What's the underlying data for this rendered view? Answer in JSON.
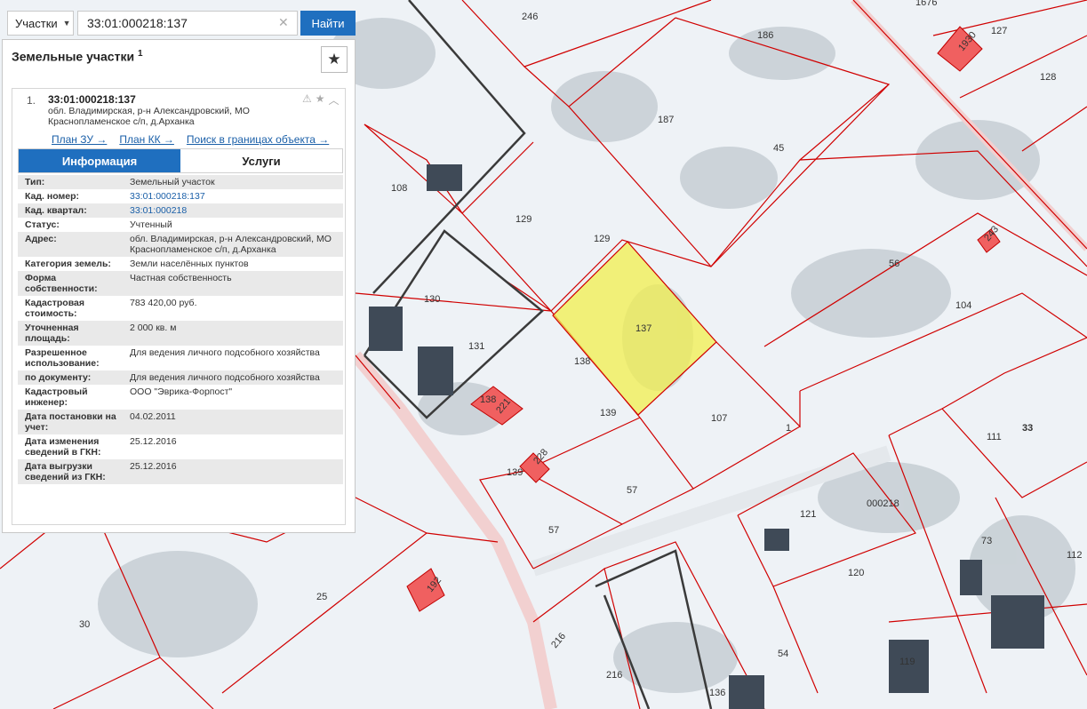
{
  "search": {
    "type_label": "Участки",
    "query": "33:01:000218:137",
    "find_label": "Найти"
  },
  "panel": {
    "title": "Земельные участки",
    "count": "1"
  },
  "result": {
    "index": "1.",
    "cad_number": "33:01:000218:137",
    "address": "обл. Владимирская, р-н Александровский, МО Краснопламенское с/п, д.Арханка",
    "links": {
      "plan_zu": "План ЗУ →",
      "plan_kk": "План КК →",
      "search_bounds": "Поиск в границах объекта →"
    },
    "tabs": {
      "info": "Информация",
      "services": "Услуги"
    },
    "details": [
      {
        "key": "Тип:",
        "value": "Земельный участок"
      },
      {
        "key": "Кад. номер:",
        "value": "33:01:000218:137"
      },
      {
        "key": "Кад. квартал:",
        "value": "33:01:000218"
      },
      {
        "key": "Статус:",
        "value": "Учтенный"
      },
      {
        "key": "Адрес:",
        "value": "обл. Владимирская, р-н Александровский, МО Краснопламенское с/п, д.Арханка"
      },
      {
        "key": "Категория земель:",
        "value": "Земли населённых пунктов"
      },
      {
        "key": "Форма собственности:",
        "value": "Частная собственность"
      },
      {
        "key": "Кадастровая стоимость:",
        "value": "783 420,00 руб."
      },
      {
        "key": "Уточненная площадь:",
        "value": "2 000 кв. м"
      },
      {
        "key": "Разрешенное использование:",
        "value": "Для ведения личного подсобного хозяйства"
      },
      {
        "key": "по документу:",
        "value": "Для ведения личного подсобного хозяйства"
      },
      {
        "key": "Кадастровый инженер:",
        "value": "ООО \"Эврика-Форпост\""
      },
      {
        "key": "Дата постановки на учет:",
        "value": "04.02.2011"
      },
      {
        "key": "Дата изменения сведений в ГКН:",
        "value": "25.12.2016"
      },
      {
        "key": "Дата выгрузки сведений из ГКН:",
        "value": "25.12.2016"
      }
    ]
  },
  "map": {
    "parcel_labels": [
      "246",
      "186",
      "1676",
      "127",
      "1930",
      "128",
      "187",
      "45",
      "108",
      "129",
      "129",
      "137",
      "56",
      "243",
      "104",
      "130",
      "131",
      "138",
      "138",
      "221",
      "139",
      "107",
      "1",
      "33",
      "111",
      "139",
      "228",
      "57",
      "57",
      "121",
      "000218",
      "73",
      "112",
      "120",
      "25",
      "30",
      "192",
      "216",
      "216",
      "54",
      "136",
      "119"
    ],
    "colors": {
      "boundary": "#d00000",
      "highlight": "#f2ef4d",
      "snow": "#eef2f6"
    }
  }
}
